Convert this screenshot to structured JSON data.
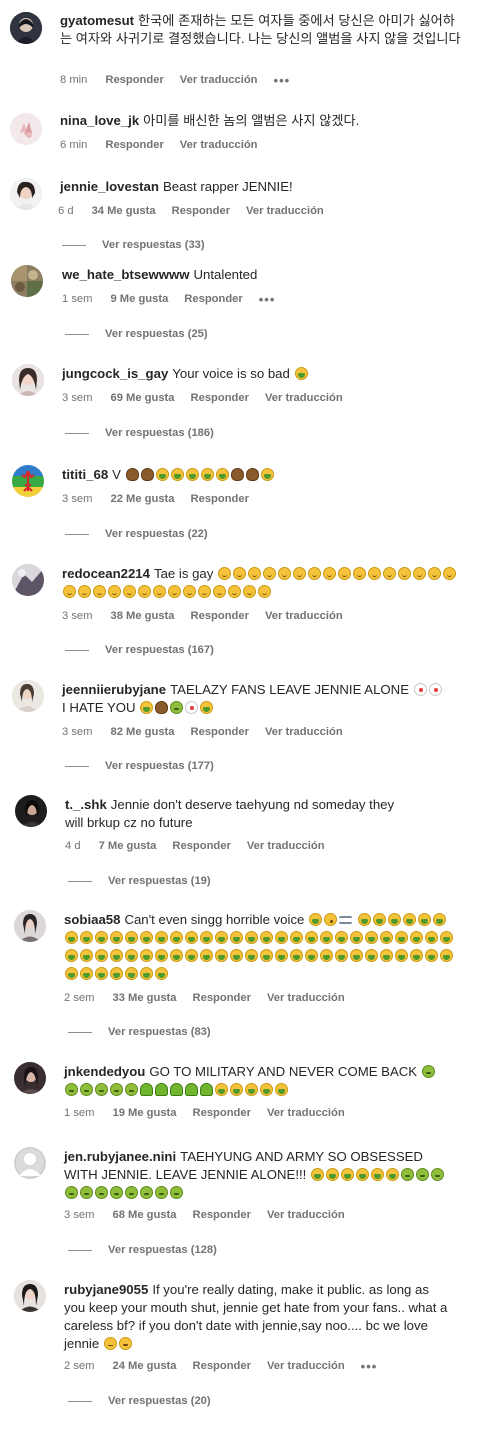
{
  "ui": {
    "reply_label": "Responder",
    "translate_label": "Ver traducción",
    "more_label": "•••"
  },
  "comments": [
    {
      "username": "gyatomesut",
      "text": "한국에 존재하는 모든 여자들 중에서 당신은 아미가 싫어하는 여자와 사귀기로 결정했습니다. 나는 당신의 앨범을 사지 않을 것입니다",
      "time": "8 min",
      "likes": "",
      "replies": ""
    },
    {
      "username": "nina_love_jk",
      "text": "아미를 배신한 놈의 앨범은 사지 않겠다.",
      "time": "6 min",
      "likes": "",
      "replies": ""
    },
    {
      "username": "jennie_lovestan",
      "text": "Beast rapper JENNIE!",
      "time": "6 d",
      "likes": "34 Me gusta",
      "replies": "Ver respuestas (33)"
    },
    {
      "username": "we_hate_btsewwww",
      "text": "Untalented",
      "time": "1 sem",
      "likes": "9 Me gusta",
      "replies": "Ver respuestas (25)"
    },
    {
      "username": "jungcock_is_gay",
      "text": "Your voice is so bad",
      "time": "3 sem",
      "likes": "69 Me gusta",
      "replies": "Ver respuestas (186)"
    },
    {
      "username": "tititi_68",
      "text": "V",
      "time": "3 sem",
      "likes": "22 Me gusta",
      "replies": "Ver respuestas (22)"
    },
    {
      "username": "redocean2214",
      "text": "Tae is gay",
      "time": "3 sem",
      "likes": "38 Me gusta",
      "replies": "Ver respuestas (167)"
    },
    {
      "username": "jeenniieruby​jane",
      "text": "TAELAZY FANS LEAVE JENNIE ALONE",
      "text2": "I HATE YOU",
      "time": "3 sem",
      "likes": "82 Me gusta",
      "replies": "Ver respuestas (177)"
    },
    {
      "username": "t._.shk",
      "text": "Jennie don't deserve taehyung nd someday they will brkup cz no future",
      "time": "4 d",
      "likes": "7 Me gusta",
      "replies": "Ver respuestas (19)"
    },
    {
      "username": "sobiaa58",
      "text": "Can't even singg horrible voice",
      "time": "2 sem",
      "likes": "33 Me gusta",
      "replies": "Ver respuestas (83)"
    },
    {
      "username": "jnkendedyou",
      "text": "GO TO MILITARY AND NEVER COME BACK",
      "time": "1 sem",
      "likes": "19 Me gusta",
      "replies": ""
    },
    {
      "username": "jen.rubyjanee.nini",
      "text": "TAEHYUNG AND ARMY SO OBSESSED WITH JENNIE. LEAVE JENNIE ALONE!!!",
      "time": "3 sem",
      "likes": "68 Me gusta",
      "replies": "Ver respuestas (128)"
    },
    {
      "username": "rubyjane9055",
      "text": "If you're really dating, make it public. as long as you keep your mouth shut, jennie get hate from your fans.. what a careless bf? if you don't date with jennie,say noo.... bc we love jennie",
      "time": "2 sem",
      "likes": "24 Me gusta",
      "replies": "Ver respuestas (20)"
    }
  ]
}
